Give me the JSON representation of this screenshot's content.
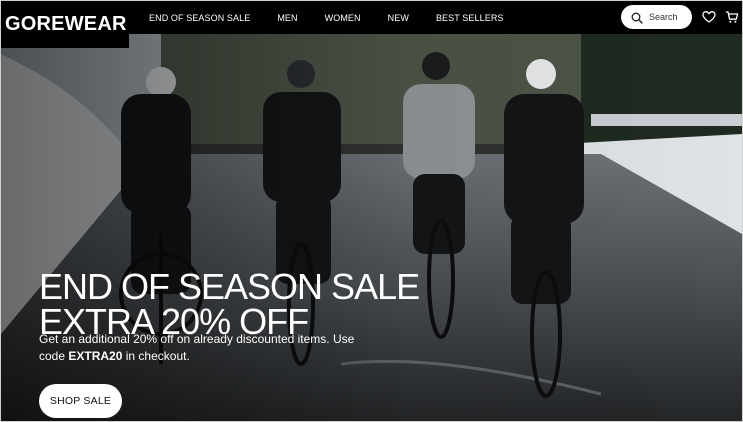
{
  "header": {
    "logo": "GOREWEAR",
    "nav": [
      {
        "label": "END OF SEASON SALE"
      },
      {
        "label": "MEN"
      },
      {
        "label": "WOMEN"
      },
      {
        "label": "NEW"
      },
      {
        "label": "BEST SELLERS"
      }
    ],
    "search_label": "Search",
    "icons": [
      "search-icon",
      "heart-icon",
      "cart-icon"
    ]
  },
  "hero": {
    "title_line1": "END OF SEASON SALE",
    "title_line2": "EXTRA 20% OFF",
    "subtitle_prefix": "Get an additional 20% off on already discounted items. Use code",
    "code": "EXTRA20",
    "subtitle_suffix": "in checkout.",
    "cta_label": "SHOP SALE"
  },
  "colors": {
    "header_bg": "#000000",
    "cta_bg": "#ffffff",
    "text_light": "#ffffff"
  }
}
